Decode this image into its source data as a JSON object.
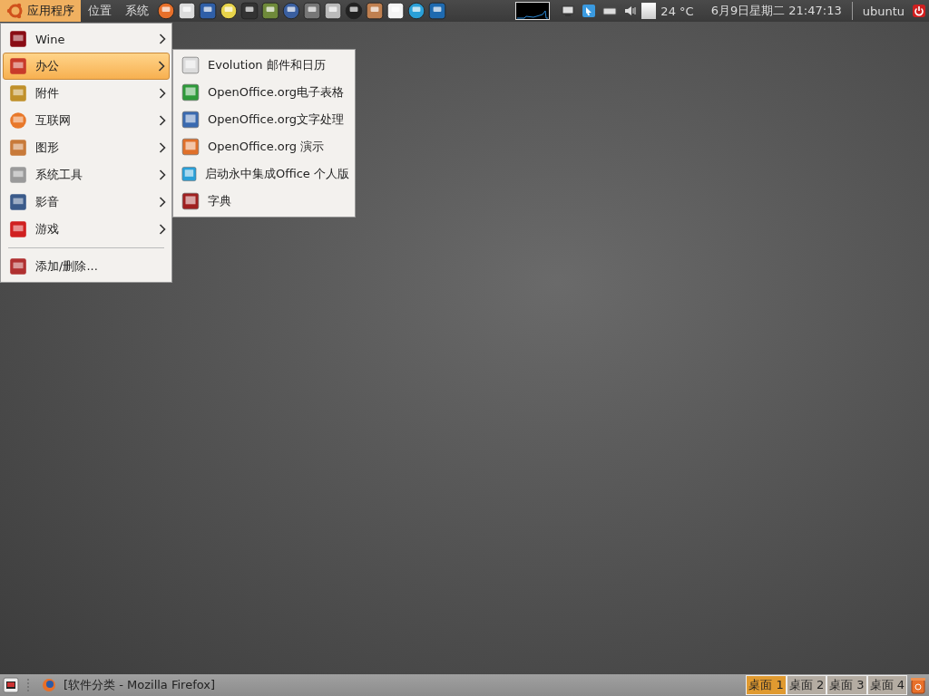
{
  "top_panel": {
    "menus": [
      {
        "label": "应用程序",
        "selected": true
      },
      {
        "label": "位置",
        "selected": false
      },
      {
        "label": "系统",
        "selected": false
      }
    ],
    "temperature": "24 °C",
    "clock": "6月9日星期二 21:47:13",
    "user": "ubuntu"
  },
  "applications_menu": {
    "items": [
      {
        "kind": "submenu",
        "label": "Wine",
        "selected": false
      },
      {
        "kind": "submenu",
        "label": "办公",
        "selected": true
      },
      {
        "kind": "submenu",
        "label": "附件",
        "selected": false
      },
      {
        "kind": "submenu",
        "label": "互联网",
        "selected": false
      },
      {
        "kind": "submenu",
        "label": "图形",
        "selected": false
      },
      {
        "kind": "submenu",
        "label": "系统工具",
        "selected": false
      },
      {
        "kind": "submenu",
        "label": "影音",
        "selected": false
      },
      {
        "kind": "submenu",
        "label": "游戏",
        "selected": false
      },
      {
        "kind": "separator"
      },
      {
        "kind": "action",
        "label": "添加/删除...",
        "selected": false
      }
    ]
  },
  "office_submenu": {
    "items": [
      "Evolution 邮件和日历",
      "OpenOffice.org电子表格",
      "OpenOffice.org文字处理",
      "OpenOffice.org 演示",
      "启动永中集成Office 个人版",
      "字典"
    ]
  },
  "bottom_panel": {
    "tasks": [
      {
        "label": "[软件分类 - Mozilla Firefox]"
      }
    ],
    "workspaces": [
      {
        "label": "桌面 1",
        "selected": true
      },
      {
        "label": "桌面 2",
        "selected": false
      },
      {
        "label": "桌面 3",
        "selected": false
      },
      {
        "label": "桌面 4",
        "selected": false
      }
    ]
  }
}
